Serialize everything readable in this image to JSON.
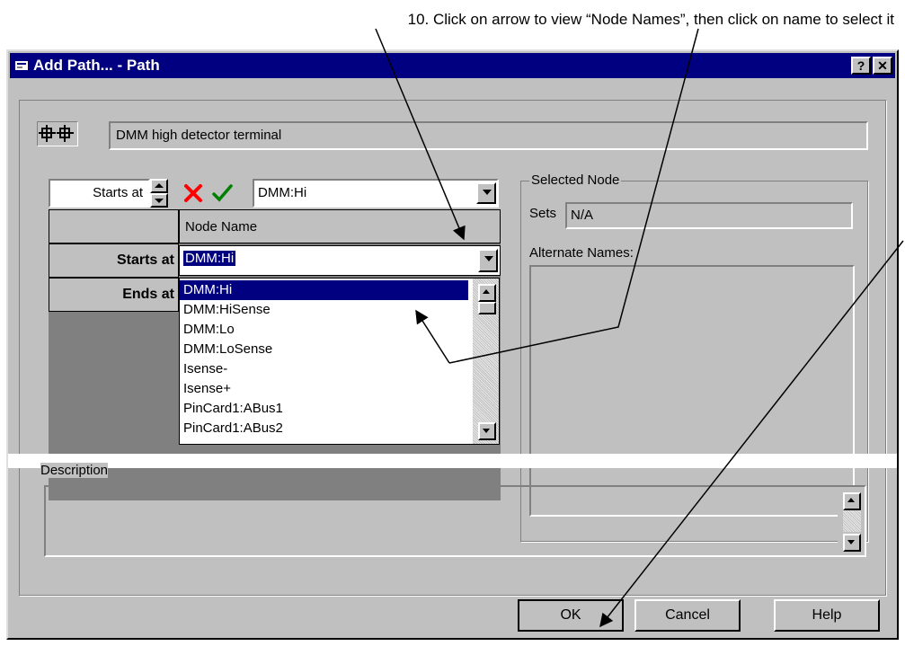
{
  "instruction": "10. Click on arrow to view “Node Names”, then click on name to select it",
  "window": {
    "title": "Add Path... - Path",
    "help_btn": "?",
    "close_btn": "✕"
  },
  "path": {
    "description": "DMM high detector terminal"
  },
  "toolbar": {
    "mode_value": "Starts at",
    "node_value": "DMM:Hi"
  },
  "grid": {
    "column_header": "Node Name",
    "rows": [
      {
        "label": "Starts at",
        "value": "DMM:Hi"
      },
      {
        "label": "Ends at",
        "value": ""
      }
    ]
  },
  "node_list": [
    "DMM:Hi",
    "DMM:HiSense",
    "DMM:Lo",
    "DMM:LoSense",
    "Isense-",
    "Isense+",
    "PinCard1:ABus1",
    "PinCard1:ABus2"
  ],
  "selected_node": {
    "group_label": "Selected Node",
    "sets_label": "Sets",
    "sets_value": "N/A",
    "alternate_names_label": "Alternate Names:"
  },
  "description_section": {
    "label": "Description",
    "value": ""
  },
  "buttons": {
    "ok": "OK",
    "cancel": "Cancel",
    "help": "Help"
  },
  "colors": {
    "titlebar": "#000080",
    "selection": "#000080",
    "face": "#c0c0c0",
    "delete_icon": "#ff0000",
    "accept_icon": "#008000"
  }
}
